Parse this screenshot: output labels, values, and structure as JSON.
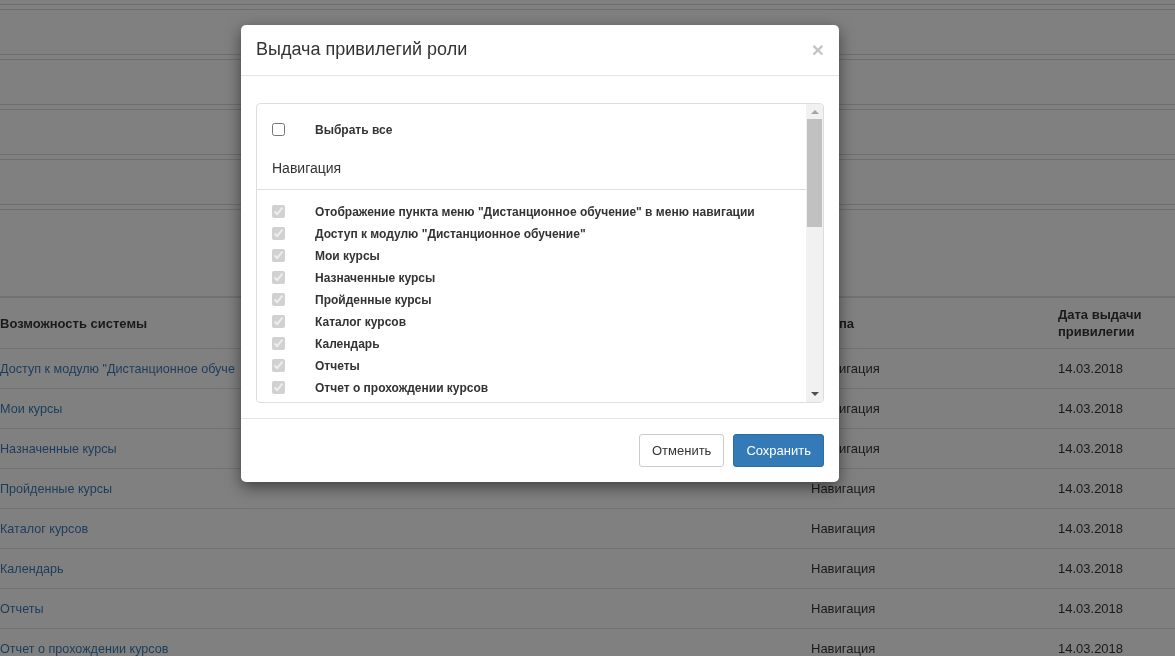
{
  "background_page": {
    "columns": [
      "Возможность системы",
      "па",
      "Дата выдачи привилегии"
    ],
    "rows": [
      {
        "capability": "Доступ к модулю \"Дистанционное обуче",
        "group": "игация",
        "date": "14.03.2018"
      },
      {
        "capability": "Мои курсы",
        "group": "игация",
        "date": "14.03.2018"
      },
      {
        "capability": "Назначенные курсы",
        "group": "игация",
        "date": "14.03.2018"
      },
      {
        "capability": "Пройденные курсы",
        "group": "Навигация",
        "date": "14.03.2018"
      },
      {
        "capability": "Каталог курсов",
        "group": "Навигация",
        "date": "14.03.2018"
      },
      {
        "capability": "Календарь",
        "group": "Навигация",
        "date": "14.03.2018"
      },
      {
        "capability": "Отчеты",
        "group": "Навигация",
        "date": "14.03.2018"
      },
      {
        "capability": "Отчет о прохождении курсов",
        "group": "Навигация",
        "date": "14.03.2018"
      }
    ]
  },
  "dialog": {
    "title": "Выдача привилегий роли",
    "close_symbol": "×",
    "select_all": {
      "label": "Выбрать все",
      "checked": false
    },
    "section": "Навигация",
    "privileges": [
      {
        "label": "Отображение пункта меню \"Дистанционное обучение\" в меню навигации",
        "checked": true,
        "disabled": true
      },
      {
        "label": "Доступ к модулю \"Дистанционное обучение\"",
        "checked": true,
        "disabled": true
      },
      {
        "label": "Мои курсы",
        "checked": true,
        "disabled": true
      },
      {
        "label": "Назначенные курсы",
        "checked": true,
        "disabled": true
      },
      {
        "label": "Пройденные курсы",
        "checked": true,
        "disabled": true
      },
      {
        "label": "Каталог курсов",
        "checked": true,
        "disabled": true
      },
      {
        "label": "Календарь",
        "checked": true,
        "disabled": true
      },
      {
        "label": "Отчеты",
        "checked": true,
        "disabled": true
      },
      {
        "label": "Отчет о прохождении курсов",
        "checked": true,
        "disabled": true
      }
    ],
    "buttons": [
      {
        "label": "Отменить",
        "kind": "secondary"
      },
      {
        "label": "Сохранить",
        "kind": "primary"
      }
    ]
  }
}
